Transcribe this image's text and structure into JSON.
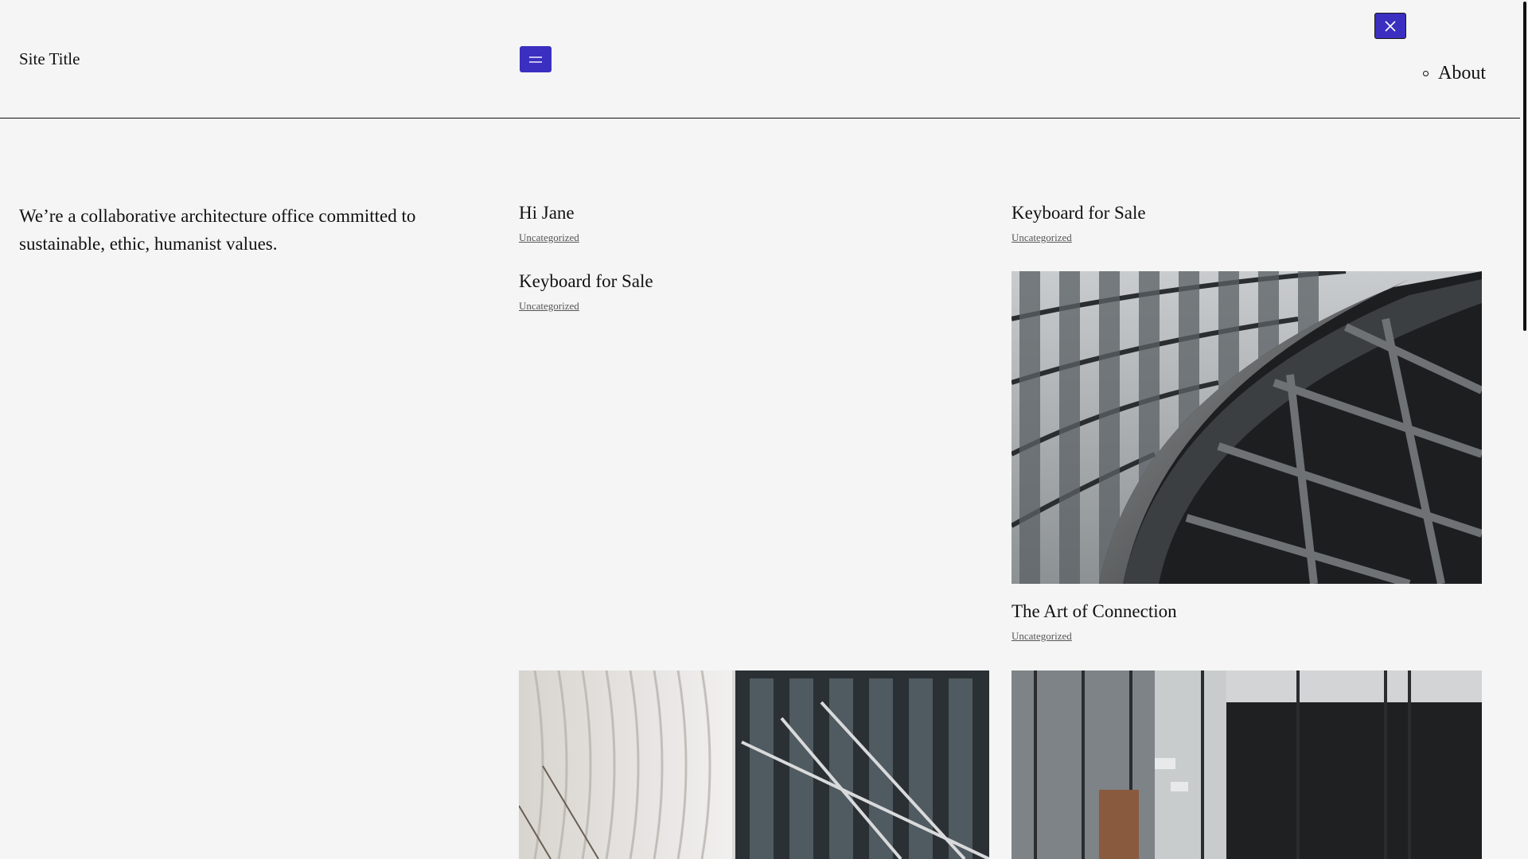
{
  "header": {
    "site_title": "Site Title",
    "nav": [
      {
        "label": "About"
      }
    ]
  },
  "intro": {
    "tagline": "We’re a collaborative architecture office committed to sustainable, ethic, humanist values."
  },
  "posts": [
    {
      "title": "Hi Jane",
      "category": "Uncategorized"
    },
    {
      "title": "Keyboard for Sale",
      "category": "Uncategorized"
    },
    {
      "title": "Keyboard for Sale",
      "category": "Uncategorized"
    },
    {
      "title": "The Art of Connection",
      "category": "Uncategorized"
    }
  ],
  "colors": {
    "accent": "#3a2fc0",
    "background": "#f5f5f5",
    "text": "#111111"
  },
  "icons": {
    "menu_open": "hamburger-icon",
    "menu_close": "close-icon"
  }
}
